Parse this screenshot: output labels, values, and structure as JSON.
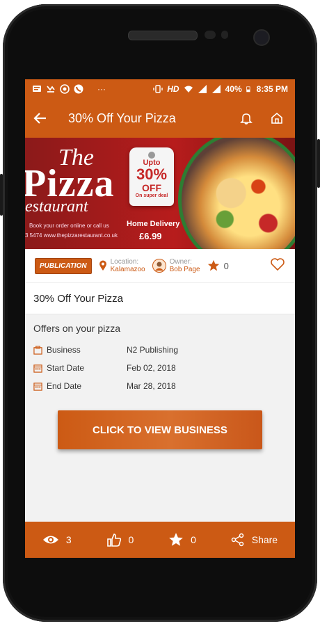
{
  "status_bar": {
    "left_icons": [
      "message-icon",
      "missed-call-icon",
      "whatsapp-icon",
      "phone-icon",
      "more-dots-icon"
    ],
    "more_text": "···",
    "network": "HD",
    "battery": "40%",
    "time": "8:35 PM"
  },
  "app_bar": {
    "title": "30% Off Your Pizza",
    "back_icon": "arrow-back-icon",
    "bell_icon": "bell-icon",
    "home_icon": "home-icon"
  },
  "banner": {
    "line1": "The",
    "line2": "Pizza",
    "line3": "estaurant",
    "small1": "Book your order online or call us",
    "small2": "3 5474 www.thepizzarestaurant.co.uk",
    "tag_upto": "Upto",
    "tag_pct": "30%",
    "tag_off": "OFF",
    "tag_deal": "On super deal",
    "delivery": "Home Delivery",
    "price": "£6.99"
  },
  "info": {
    "category": "PUBLICATION",
    "location_label": "Location:",
    "location_value": "Kalamazoo",
    "owner_label": "Owner:",
    "owner_value": "Bob Page",
    "rating": "0"
  },
  "listing_title": "30% Off Your Pizza",
  "details": {
    "subtitle": "Offers on your pizza",
    "rows": [
      {
        "label": "Business",
        "value": "N2 Publishing"
      },
      {
        "label": "Start Date",
        "value": "Feb 02, 2018"
      },
      {
        "label": "End Date",
        "value": "Mar 28, 2018"
      }
    ]
  },
  "cta": "CLICK TO VIEW BUSINESS",
  "bottom": {
    "views": "3",
    "likes": "0",
    "stars": "0",
    "share": "Share"
  },
  "colors": {
    "accent": "#cc5a14"
  }
}
